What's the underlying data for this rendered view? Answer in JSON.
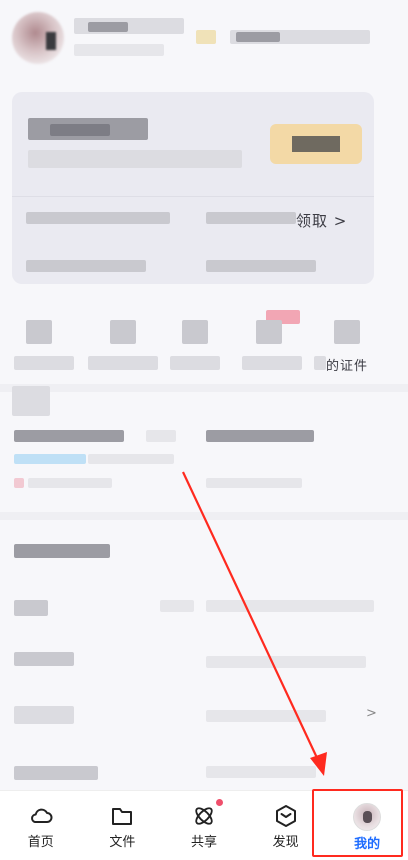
{
  "header": {
    "avatar_icon": "user-avatar"
  },
  "card": {
    "visible_fragments": {
      "row1_right": "领取 >"
    }
  },
  "grid": {
    "visible_fragments": {
      "item5": "的证件"
    }
  },
  "list": {
    "visible_fragments": {
      "row4_right": ">"
    }
  },
  "bottom_nav": {
    "items": [
      {
        "label": "首页",
        "icon": "cloud-icon"
      },
      {
        "label": "文件",
        "icon": "folder-icon"
      },
      {
        "label": "共享",
        "icon": "atom-icon",
        "badge_dot": true
      },
      {
        "label": "发现",
        "icon": "cube-icon"
      },
      {
        "label": "我的",
        "icon": "avatar-icon",
        "active": true
      }
    ]
  },
  "colors": {
    "accent": "#1f6dff",
    "annotation": "#ff2a1f",
    "badge": "#ef4f6b"
  }
}
